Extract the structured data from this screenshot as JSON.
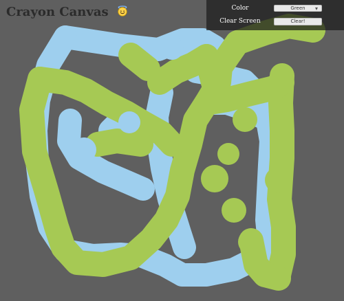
{
  "app": {
    "title": "Crayon Canvas",
    "emoji_icon": "smiling-face-with-halo-icon"
  },
  "controls": {
    "color_label": "Color",
    "color_value": "Green",
    "clear_label": "Clear Screen",
    "clear_button": "Clear!"
  },
  "canvas": {
    "background": "#5f5f5f",
    "stroke_colors": {
      "blue": "#9ecfee",
      "green": "#a6c954"
    }
  },
  "panel": {
    "background": "#1c1c1c"
  }
}
